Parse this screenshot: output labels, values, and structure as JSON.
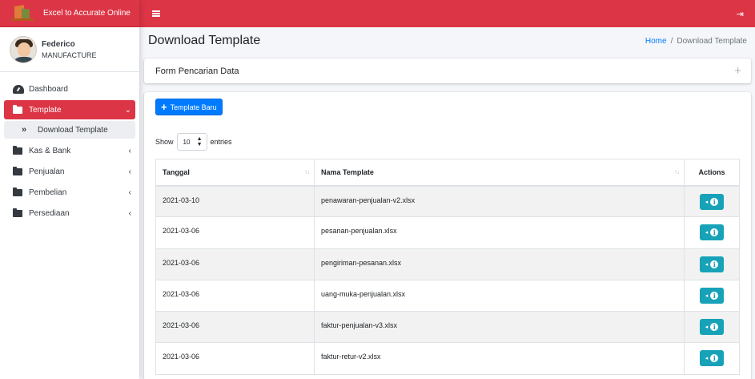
{
  "brand": {
    "title": "Excel to Accurate Online"
  },
  "user": {
    "name": "Federico",
    "role": "MANUFACTURE"
  },
  "sidebar": {
    "items": [
      {
        "label": "Dashboard",
        "icon": "dashboard-icon"
      },
      {
        "label": "Template",
        "icon": "folder-icon",
        "active": true,
        "chevron": "⌄"
      },
      {
        "label": "Download Template",
        "icon": "double-chevron-right-icon",
        "sub": true
      },
      {
        "label": "Kas & Bank",
        "icon": "folder-icon",
        "chevron": "‹"
      },
      {
        "label": "Penjualan",
        "icon": "folder-icon",
        "chevron": "‹"
      },
      {
        "label": "Pembelian",
        "icon": "folder-icon",
        "chevron": "‹"
      },
      {
        "label": "Persediaan",
        "icon": "folder-icon",
        "chevron": "‹"
      }
    ]
  },
  "topbar": {
    "menu_icon": "hamburger-icon",
    "logout_icon": "logout-icon"
  },
  "page": {
    "title": "Download Template",
    "breadcrumb": {
      "home": "Home",
      "sep": "/",
      "current": "Download Template"
    }
  },
  "search_card": {
    "title": "Form Pencarian Data",
    "toggle": "+"
  },
  "main": {
    "new_button": "Template Baru",
    "show_label": "Show",
    "entries_value": "10",
    "entries_label": "entries",
    "columns": {
      "date": "Tanggal",
      "name": "Nama Template",
      "actions": "Actions"
    },
    "rows": [
      {
        "date": "2021-03-10",
        "name": "penawaran-penjualan-v2.xlsx"
      },
      {
        "date": "2021-03-06",
        "name": "pesanan-penjualan.xlsx"
      },
      {
        "date": "2021-03-06",
        "name": "pengiriman-pesanan.xlsx"
      },
      {
        "date": "2021-03-06",
        "name": "uang-muka-penjualan.xlsx"
      },
      {
        "date": "2021-03-06",
        "name": "faktur-penjualan-v3.xlsx"
      },
      {
        "date": "2021-03-06",
        "name": "faktur-retur-v2.xlsx"
      }
    ]
  },
  "colors": {
    "primary_red": "#dc3545",
    "blue": "#007bff",
    "info": "#17a2b8"
  }
}
